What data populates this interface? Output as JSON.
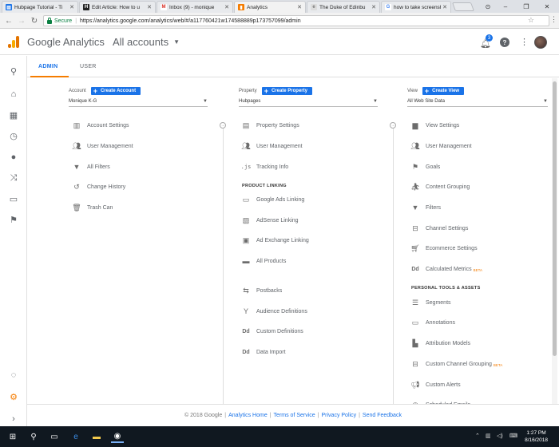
{
  "browser": {
    "tabs": [
      {
        "label": "Hubpage Tutorial - Ti",
        "favicon_color": "#1a73e8",
        "favicon_glyph": "▤",
        "active": false
      },
      {
        "label": "Edit Article: How to u",
        "favicon_color": "#222222",
        "favicon_glyph": "H",
        "active": false
      },
      {
        "label": "Inbox (9) - monique",
        "favicon_color": "#ffffff",
        "favicon_glyph": "M",
        "active": false
      },
      {
        "label": "Analytics",
        "favicon_color": "#f57c00",
        "favicon_glyph": "▮",
        "active": true
      },
      {
        "label": "The Duke of Edinbu",
        "favicon_color": "#dddddd",
        "favicon_glyph": "e",
        "active": false
      },
      {
        "label": "how to take screensh",
        "favicon_color": "#4285f4",
        "favicon_glyph": "G",
        "active": false
      }
    ],
    "secure_label": "Secure",
    "url": "https://analytics.google.com/analytics/web/#/a117760421w174588889p173757099/admin"
  },
  "header": {
    "product_google": "Google",
    "product_name": "Analytics",
    "account_selector": "All accounts",
    "notification_count": "3"
  },
  "subtabs": {
    "admin": "ADMIN",
    "user": "USER"
  },
  "account": {
    "label": "Account",
    "create_label": "Create Account",
    "selected": "Monique K-G",
    "items": [
      {
        "label": "Account Settings",
        "icon": "building-icon"
      },
      {
        "label": "User Management",
        "icon": "people-icon"
      },
      {
        "label": "All Filters",
        "icon": "filter-icon"
      },
      {
        "label": "Change History",
        "icon": "history-icon"
      },
      {
        "label": "Trash Can",
        "icon": "trash-icon"
      }
    ]
  },
  "property": {
    "label": "Property",
    "create_label": "Create Property",
    "selected": "Hubpages",
    "items": [
      {
        "label": "Property Settings",
        "icon": "settings-page-icon"
      },
      {
        "label": "User Management",
        "icon": "people-icon"
      },
      {
        "label": "Tracking Info",
        "icon": "js-icon"
      }
    ],
    "section_product_linking": "PRODUCT LINKING",
    "linking_items": [
      {
        "label": "Google Ads Linking",
        "icon": "ads-icon"
      },
      {
        "label": "AdSense Linking",
        "icon": "adsense-icon"
      },
      {
        "label": "Ad Exchange Linking",
        "icon": "adexchange-icon"
      },
      {
        "label": "All Products",
        "icon": "all-products-icon"
      }
    ],
    "other_items": [
      {
        "label": "Postbacks",
        "icon": "postbacks-icon"
      },
      {
        "label": "Audience Definitions",
        "icon": "audience-icon"
      },
      {
        "label": "Custom Definitions",
        "icon": "dd-icon"
      },
      {
        "label": "Data Import",
        "icon": "dd-icon"
      }
    ]
  },
  "view": {
    "label": "View",
    "create_label": "Create View",
    "selected": "All Web Site Data",
    "items": [
      {
        "label": "View Settings",
        "icon": "document-icon"
      },
      {
        "label": "User Management",
        "icon": "people-icon"
      },
      {
        "label": "Goals",
        "icon": "flag-icon"
      },
      {
        "label": "Content Grouping",
        "icon": "person-walk-icon"
      },
      {
        "label": "Filters",
        "icon": "filter-icon"
      },
      {
        "label": "Channel Settings",
        "icon": "channel-icon"
      },
      {
        "label": "Ecommerce Settings",
        "icon": "cart-icon"
      },
      {
        "label": "Calculated Metrics",
        "icon": "dd-icon",
        "badge": "BETA"
      }
    ],
    "section_personal": "PERSONAL TOOLS & ASSETS",
    "personal_items": [
      {
        "label": "Segments",
        "icon": "segments-icon"
      },
      {
        "label": "Annotations",
        "icon": "annotation-icon"
      },
      {
        "label": "Attribution Models",
        "icon": "bar-chart-icon"
      },
      {
        "label": "Custom Channel Grouping",
        "icon": "channel-icon",
        "badge": "BETA"
      },
      {
        "label": "Custom Alerts",
        "icon": "megaphone-icon"
      },
      {
        "label": "Scheduled Emails",
        "icon": "clock-icon"
      }
    ]
  },
  "footer": {
    "copyright": "© 2018 Google",
    "links": [
      "Analytics Home",
      "Terms of Service",
      "Privacy Policy",
      "Send Feedback"
    ]
  },
  "taskbar": {
    "time": "1:27 PM",
    "date": "8/16/2018"
  },
  "colors": {
    "accent": "#1a73e8",
    "orange": "#f57c00"
  }
}
